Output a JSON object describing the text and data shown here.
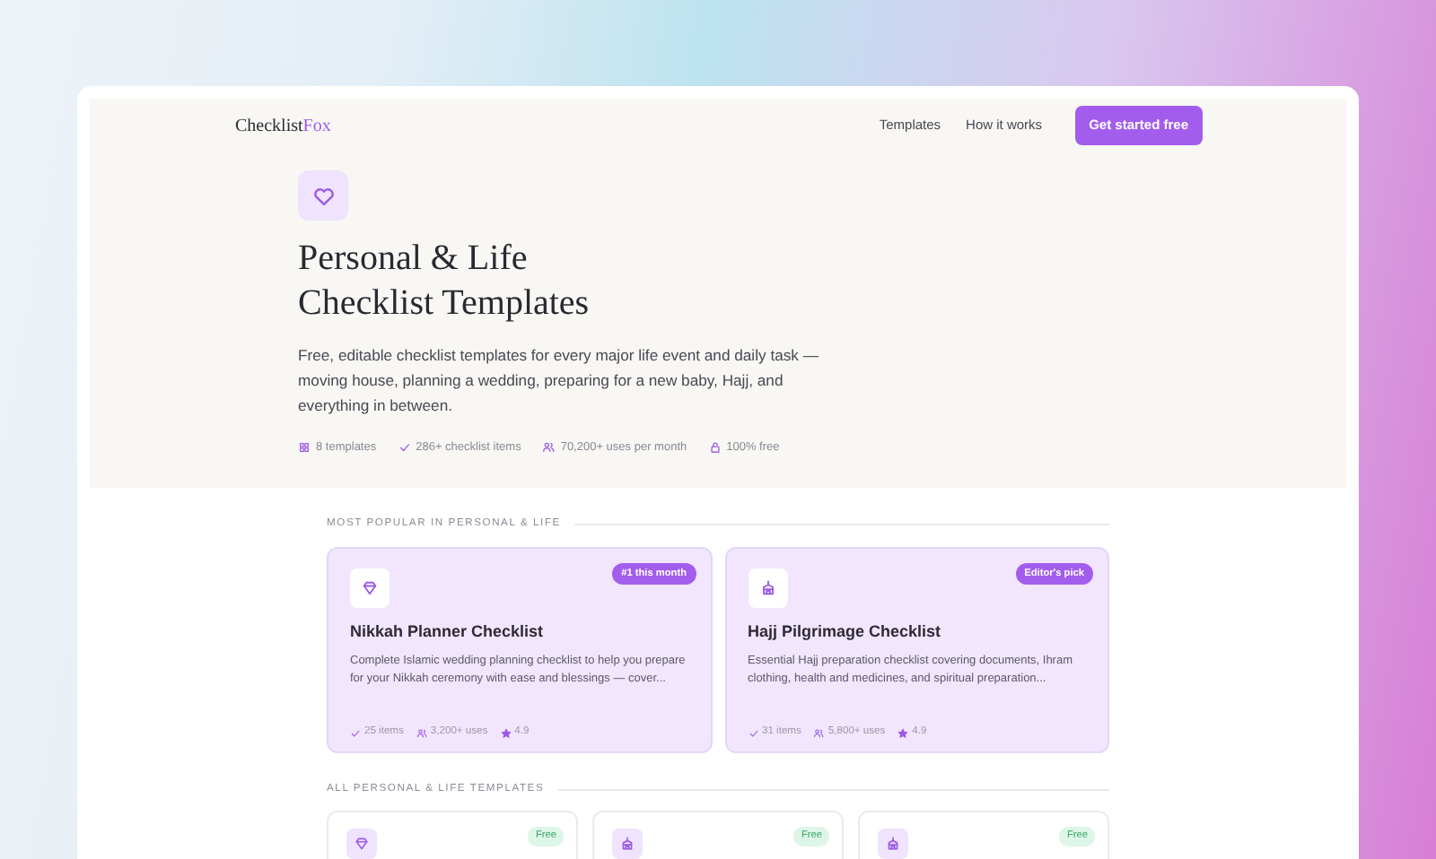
{
  "brand": {
    "main": "Checklist",
    "accent": "Fox"
  },
  "nav": {
    "links": [
      "Templates",
      "How it works"
    ],
    "cta": "Get started free"
  },
  "hero": {
    "kind": "heart",
    "title": [
      "Personal & Life",
      "Checklist Templates"
    ],
    "description": "Free, editable checklist templates for every major life event and daily task — moving house, planning a wedding, preparing for a new baby, Hajj, and everything in between.",
    "stats": [
      {
        "kind": "grid",
        "text": "8 templates"
      },
      {
        "kind": "check",
        "text": "286+ checklist items"
      },
      {
        "kind": "people",
        "text": "70,200+ uses per month"
      },
      {
        "kind": "lock",
        "text": "100% free"
      }
    ]
  },
  "popular": {
    "label": "MOST POPULAR IN PERSONAL & LIFE",
    "cards": [
      {
        "kind": "gem",
        "badge": "#1 this month",
        "title": "Nikkah Planner Checklist",
        "description": "Complete Islamic wedding planning checklist to help you prepare for your Nikkah ceremony with ease and blessings — cover...",
        "items": "25 items",
        "uses": "3,200+ uses",
        "rating": "4.9"
      },
      {
        "kind": "kaaba",
        "badge": "Editor's pick",
        "title": "Hajj Pilgrimage Checklist",
        "description": "Essential Hajj preparation checklist covering documents, Ihram clothing, health and medicines, and spiritual preparation...",
        "items": "31 items",
        "uses": "5,800+ uses",
        "rating": "4.9"
      }
    ]
  },
  "all": {
    "label": "ALL PERSONAL & LIFE TEMPLATES",
    "cards": [
      {
        "kind": "gem",
        "badge": "Free"
      },
      {
        "kind": "kaaba",
        "badge": "Free"
      },
      {
        "kind": "kaaba",
        "badge": "Free"
      }
    ]
  }
}
